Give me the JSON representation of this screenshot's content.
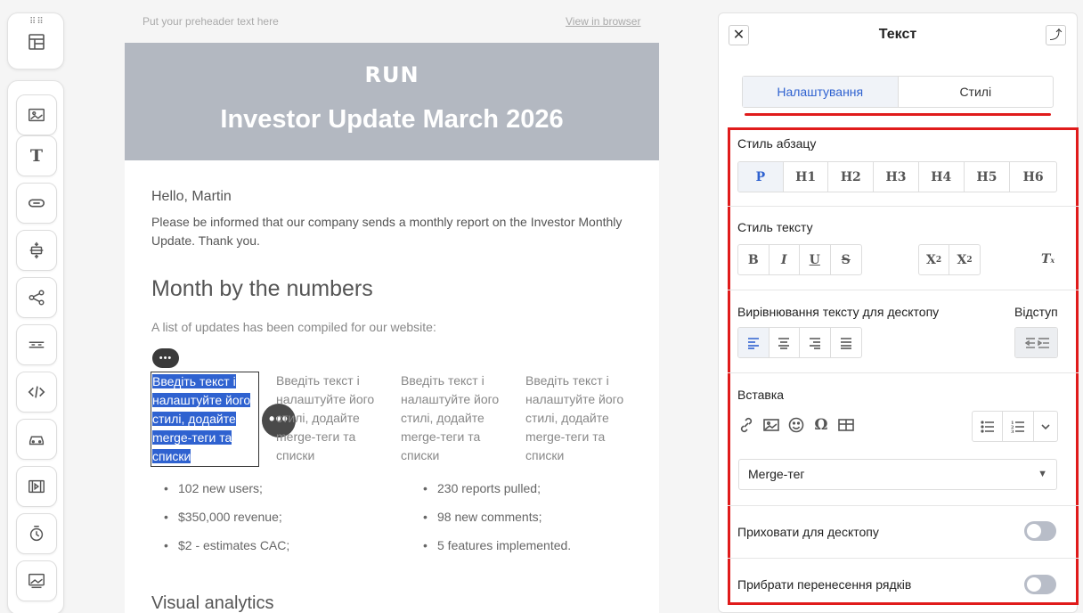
{
  "email": {
    "preheader": "Put your preheader text here",
    "view_in_browser": "View in browser",
    "logo": "RUN",
    "title": "Investor Update March 2026",
    "greeting": "Hello, Martin",
    "intro": "Please be informed that our company sends a monthly report on the Investor Monthly Update. Thank you.",
    "heading": "Month by the numbers",
    "subtext": "A list of updates has been compiled for our website:",
    "columns": [
      "Введіть текст і налаштуйте його стилі, додайте merge-теги та списки",
      "Введіть текст і налаштуйте його стилі, додайте merge-теги та списки",
      "Введіть текст і налаштуйте його стилі, додайте merge-теги та списки",
      "Введіть текст і налаштуйте його стилі, додайте merge-теги та списки"
    ],
    "list_left": [
      "102 new users;",
      "$350,000 revenue;",
      "$2 - estimates CAC;"
    ],
    "list_right": [
      "230 reports pulled;",
      "98 new comments;",
      "5 features implemented."
    ],
    "heading2": "Visual analytics"
  },
  "panel": {
    "title": "Текст",
    "tabs": [
      "Налаштування",
      "Стилі"
    ],
    "active_tab": "Налаштування",
    "paragraph_style_label": "Стиль абзацу",
    "paragraph_styles": [
      "P",
      "H1",
      "H2",
      "H3",
      "H4",
      "H5",
      "H6"
    ],
    "text_style_label": "Стиль тексту",
    "text_styles": [
      "B",
      "I",
      "U",
      "S"
    ],
    "align_label": "Вирівнювання тексту для десктопу",
    "indent_label": "Відступ",
    "insert_label": "Вставка",
    "merge_select": "Merge-тег",
    "hide_desktop_label": "Приховати для десктопу",
    "remove_breaks_label": "Прибрати перенесення рядків",
    "accent_color": "#2f62d0",
    "highlight_color": "#e01b1b"
  }
}
